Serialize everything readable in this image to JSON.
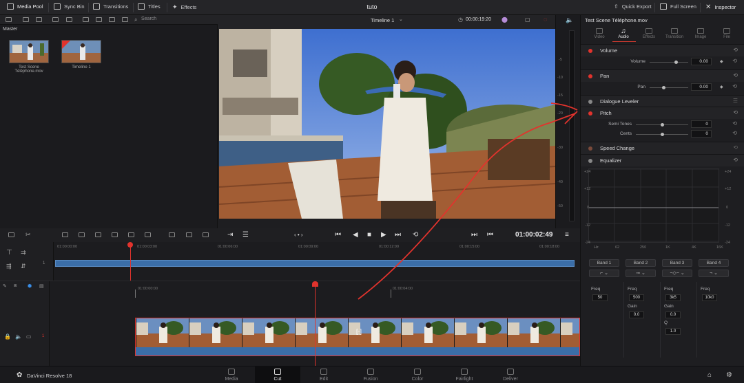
{
  "topbar": {
    "media_pool": "Media Pool",
    "sync_bin": "Sync Bin",
    "transitions": "Transitions",
    "titles": "Titles",
    "effects": "Effects",
    "title": "tuto",
    "quick_export": "Quick Export",
    "full_screen": "Full Screen",
    "inspector": "Inspector"
  },
  "toolbar2": {
    "search_placeholder": "Search"
  },
  "media_pool": {
    "bin": "Master",
    "clips": [
      {
        "name": "Test Scene Téléphone.mov"
      },
      {
        "name": "Timeline 1"
      }
    ]
  },
  "viewer": {
    "timeline_name": "Timeline 1",
    "duration": "00:00:19:20",
    "timecode": "01:00:02:49"
  },
  "meter": {
    "scale": [
      "-5",
      "-10",
      "-15",
      "-20",
      "-30",
      "-40",
      "-50"
    ]
  },
  "inspector": {
    "file_name": "Test Scene Téléphone.mov",
    "tabs": [
      "Video",
      "Audio",
      "Effects",
      "Transition",
      "Image",
      "File"
    ],
    "active_tab": "Audio",
    "volume": {
      "label": "Volume",
      "param": "Volume",
      "value": "0.00"
    },
    "pan": {
      "label": "Pan",
      "param": "Pan",
      "value": "0.00"
    },
    "dialogue_leveler": {
      "label": "Dialogue Leveler"
    },
    "pitch": {
      "label": "Pitch",
      "semi_tones_label": "Semi Tones",
      "semi_tones": "0",
      "cents_label": "Cents",
      "cents": "0"
    },
    "speed_change": {
      "label": "Speed Change"
    },
    "equalizer": {
      "label": "Equalizer",
      "y_ticks": [
        "+24",
        "+12",
        "0",
        "-12",
        "-24"
      ],
      "x_ticks": [
        "Hz",
        "62",
        "250",
        "1K",
        "4K",
        "16K"
      ],
      "bands": [
        {
          "name": "Band 1",
          "freq_label": "Freq",
          "freq": "50"
        },
        {
          "name": "Band 2",
          "freq_label": "Freq",
          "freq": "500",
          "gain_label": "Gain",
          "gain": "0.0"
        },
        {
          "name": "Band 3",
          "freq_label": "Freq",
          "freq": "3k5",
          "gain_label": "Gain",
          "gain": "0.0",
          "q_label": "Q",
          "q": "1.0"
        },
        {
          "name": "Band 4",
          "freq_label": "Freq",
          "freq": "10k0"
        }
      ]
    }
  },
  "timeline": {
    "upper_ruler": [
      "01:00:00:00",
      "01:00:03:00",
      "01:00:06:00",
      "01:00:09:00",
      "01:00:12:00",
      "01:00:15:00",
      "01:00:18:00"
    ],
    "lower_ruler": [
      "01:00:00:00",
      "01:00:04:00"
    ],
    "track_number": "1"
  },
  "bottombar": {
    "app_name": "DaVinci Resolve 18",
    "pages": [
      "Media",
      "Cut",
      "Edit",
      "Fusion",
      "Color",
      "Fairlight",
      "Deliver"
    ],
    "active_page": "Cut"
  },
  "colors": {
    "accent_red": "#e2332d",
    "clip_blue": "#3b6ea8",
    "active_tab": "#d33a2f"
  }
}
